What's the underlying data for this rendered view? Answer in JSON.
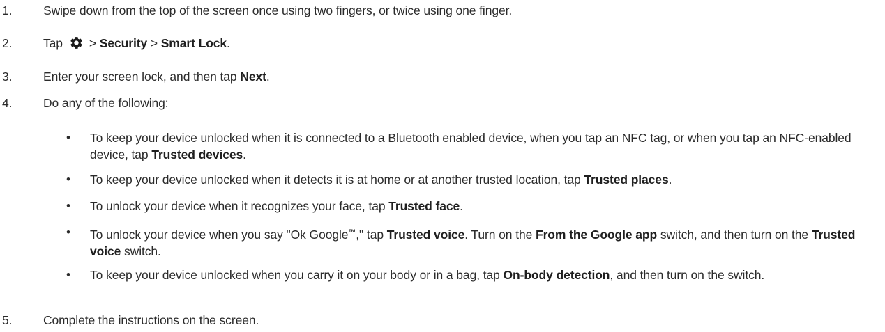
{
  "steps": [
    {
      "num": "1.",
      "text": "Swipe down from the top of the screen once using two fingers, or twice using one finger."
    },
    {
      "num": "2.",
      "tap": "Tap",
      "sep1": ">",
      "security": "Security",
      "sep2": ">",
      "smart_lock": "Smart Lock",
      "end": "."
    },
    {
      "num": "3.",
      "pre": "Enter your screen lock, and then tap ",
      "next": "Next",
      "end": "."
    },
    {
      "num": "4.",
      "text": "Do any of the following:"
    },
    {
      "num": "5.",
      "text": "Complete the instructions on the screen."
    }
  ],
  "bullets": [
    {
      "pre": "To keep your device unlocked when it is connected to a Bluetooth enabled device, when you tap an NFC tag, or when you tap an NFC-enabled device, tap ",
      "b1": "Trusted devices",
      "end": "."
    },
    {
      "pre": "To keep your device unlocked when it detects it is at home or at another trusted location, tap ",
      "b1": "Trusted places",
      "end": "."
    },
    {
      "pre": "To unlock your device when it recognizes your face, tap ",
      "b1": "Trusted face",
      "end": "."
    },
    {
      "pre": "To unlock your device when you say \"Ok Google",
      "tm": "™",
      "mid0": ",\" tap ",
      "b1": "Trusted voice",
      "mid1": ". Turn on the ",
      "b2": "From the Google app",
      "mid2": " switch, and then turn on the ",
      "b3": "Trusted voice",
      "end": " switch."
    },
    {
      "pre": "To keep your device unlocked when you carry it on your body or in a bag, tap ",
      "b1": "On-body detection",
      "end": ", and then turn on the switch."
    }
  ],
  "bullet_glyph": "•",
  "icons": {
    "settings": "gear-icon"
  }
}
